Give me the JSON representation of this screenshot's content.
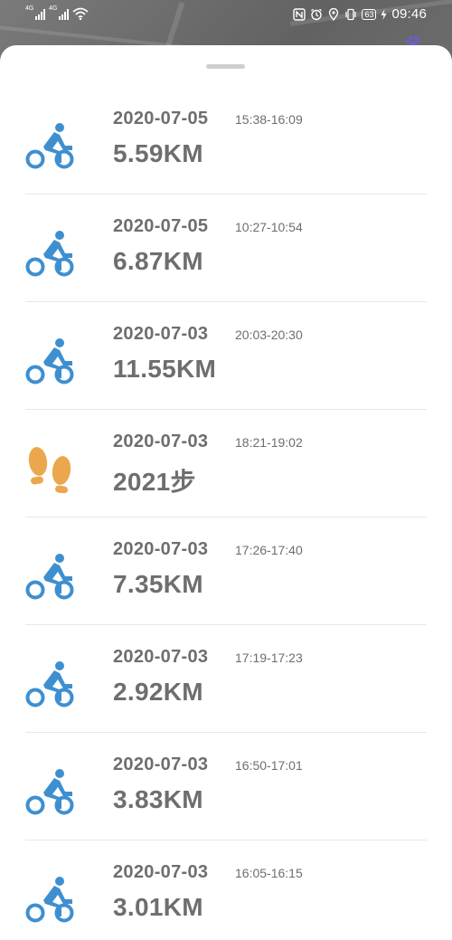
{
  "status_bar": {
    "signal_1": "4G",
    "signal_2": "4G",
    "battery": "63",
    "time": "09:46",
    "icons": [
      "wifi-icon",
      "nfc-icon",
      "alarm-icon",
      "location-icon",
      "vibrate-icon",
      "charging-icon"
    ]
  },
  "colors": {
    "cycling": "#3e8fd0",
    "walking": "#eba74e",
    "text": "#6e6e6e",
    "divider": "#e7e7e7"
  },
  "records": [
    {
      "type": "cycling",
      "icon": "bicycle-icon",
      "date": "2020-07-05",
      "time": "15:38-16:09",
      "value": "5.59KM"
    },
    {
      "type": "cycling",
      "icon": "bicycle-icon",
      "date": "2020-07-05",
      "time": "10:27-10:54",
      "value": "6.87KM"
    },
    {
      "type": "cycling",
      "icon": "bicycle-icon",
      "date": "2020-07-03",
      "time": "20:03-20:30",
      "value": "11.55KM"
    },
    {
      "type": "walking",
      "icon": "footprints-icon",
      "date": "2020-07-03",
      "time": "18:21-19:02",
      "value": "2021步"
    },
    {
      "type": "cycling",
      "icon": "bicycle-icon",
      "date": "2020-07-03",
      "time": "17:26-17:40",
      "value": "7.35KM"
    },
    {
      "type": "cycling",
      "icon": "bicycle-icon",
      "date": "2020-07-03",
      "time": "17:19-17:23",
      "value": "2.92KM"
    },
    {
      "type": "cycling",
      "icon": "bicycle-icon",
      "date": "2020-07-03",
      "time": "16:50-17:01",
      "value": "3.83KM"
    },
    {
      "type": "cycling",
      "icon": "bicycle-icon",
      "date": "2020-07-03",
      "time": "16:05-16:15",
      "value": "3.01KM"
    }
  ]
}
